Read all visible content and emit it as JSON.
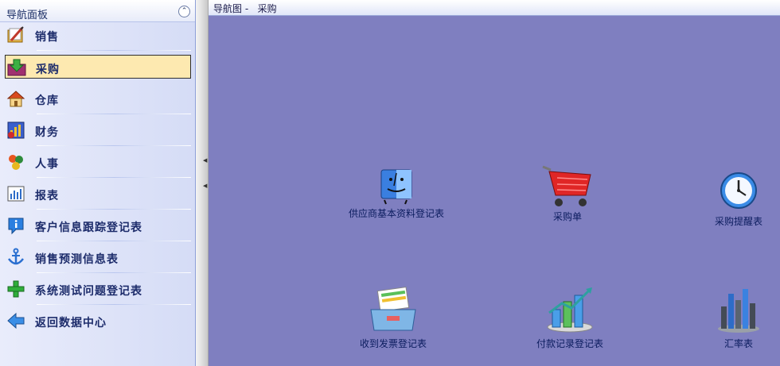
{
  "sidebar": {
    "title": "导航面板",
    "collapse_glyph": "⌃",
    "items": [
      {
        "label": "销售",
        "icon": "pencil-folder-icon"
      },
      {
        "label": "采购",
        "icon": "download-box-icon",
        "selected": true
      },
      {
        "label": "仓库",
        "icon": "house-icon"
      },
      {
        "label": "财务",
        "icon": "finance-chart-icon"
      },
      {
        "label": "人事",
        "icon": "people-icon"
      },
      {
        "label": "报表",
        "icon": "report-chart-icon"
      },
      {
        "label": "客户信息跟踪登记表",
        "icon": "info-icon"
      },
      {
        "label": "销售预测信息表",
        "icon": "anchor-icon"
      },
      {
        "label": "系统测试问题登记表",
        "icon": "plus-icon"
      },
      {
        "label": "返回数据中心",
        "icon": "back-arrow-icon"
      }
    ]
  },
  "main": {
    "breadcrumb": "导航图 -   采购",
    "tiles": [
      {
        "label": "供应商基本资料登记表",
        "icon": "finder-face-icon"
      },
      {
        "label": "采购单",
        "icon": "shopping-cart-icon"
      },
      {
        "label": "采购提醒表",
        "icon": "clock-icon"
      },
      {
        "label": "收到发票登记表",
        "icon": "invoice-tray-icon"
      },
      {
        "label": "付款记录登记表",
        "icon": "growth-bar-chart-icon"
      },
      {
        "label": "汇率表",
        "icon": "city-bars-icon"
      }
    ]
  },
  "colors": {
    "main_background": "#7f7fc0",
    "selected_item": "#fde9b0",
    "label_text": "#1d2c6b"
  }
}
